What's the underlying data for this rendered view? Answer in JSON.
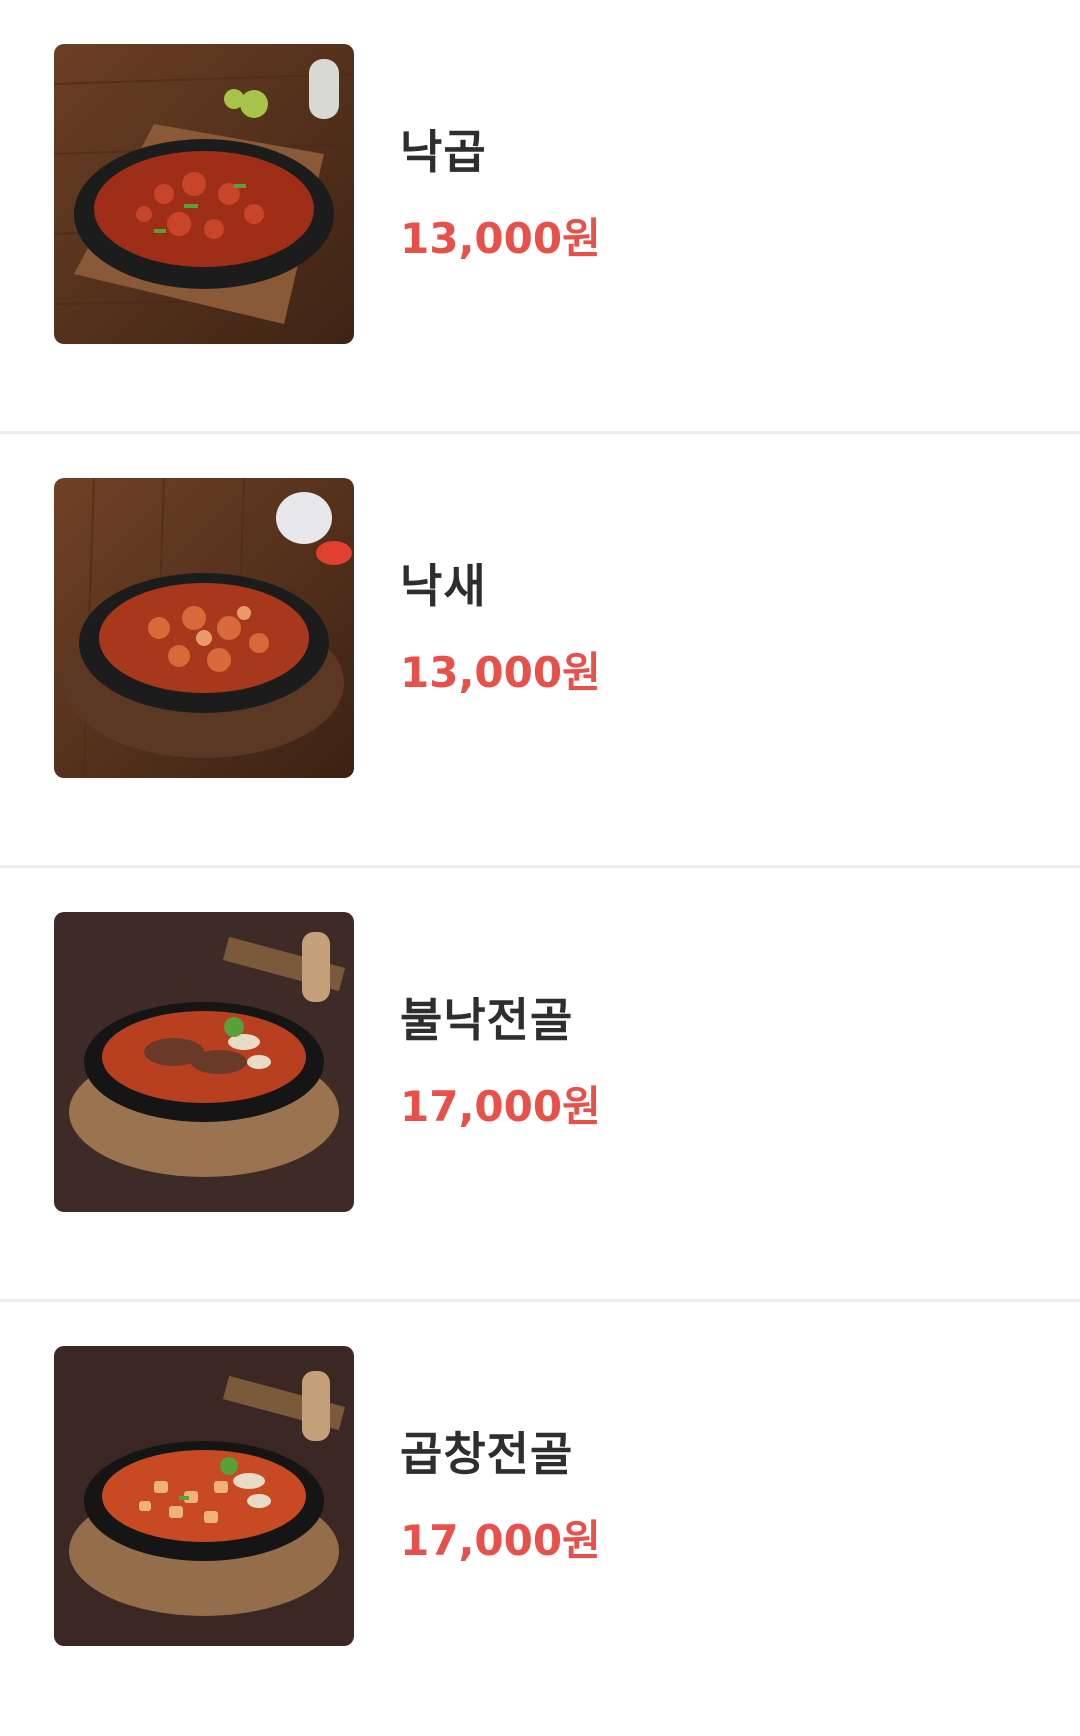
{
  "menu": {
    "items": [
      {
        "name": "낙곱",
        "price": "13,000원",
        "image": "nakgop-dish-image"
      },
      {
        "name": "낙새",
        "price": "13,000원",
        "image": "naksae-dish-image"
      },
      {
        "name": "불낙전골",
        "price": "17,000원",
        "image": "bulnak-jeongol-image"
      },
      {
        "name": "곱창전골",
        "price": "17,000원",
        "image": "gopchang-jeongol-image"
      }
    ]
  },
  "colors": {
    "price": "#e8504a",
    "name": "#2e2e2e",
    "divider": "#ededed"
  }
}
